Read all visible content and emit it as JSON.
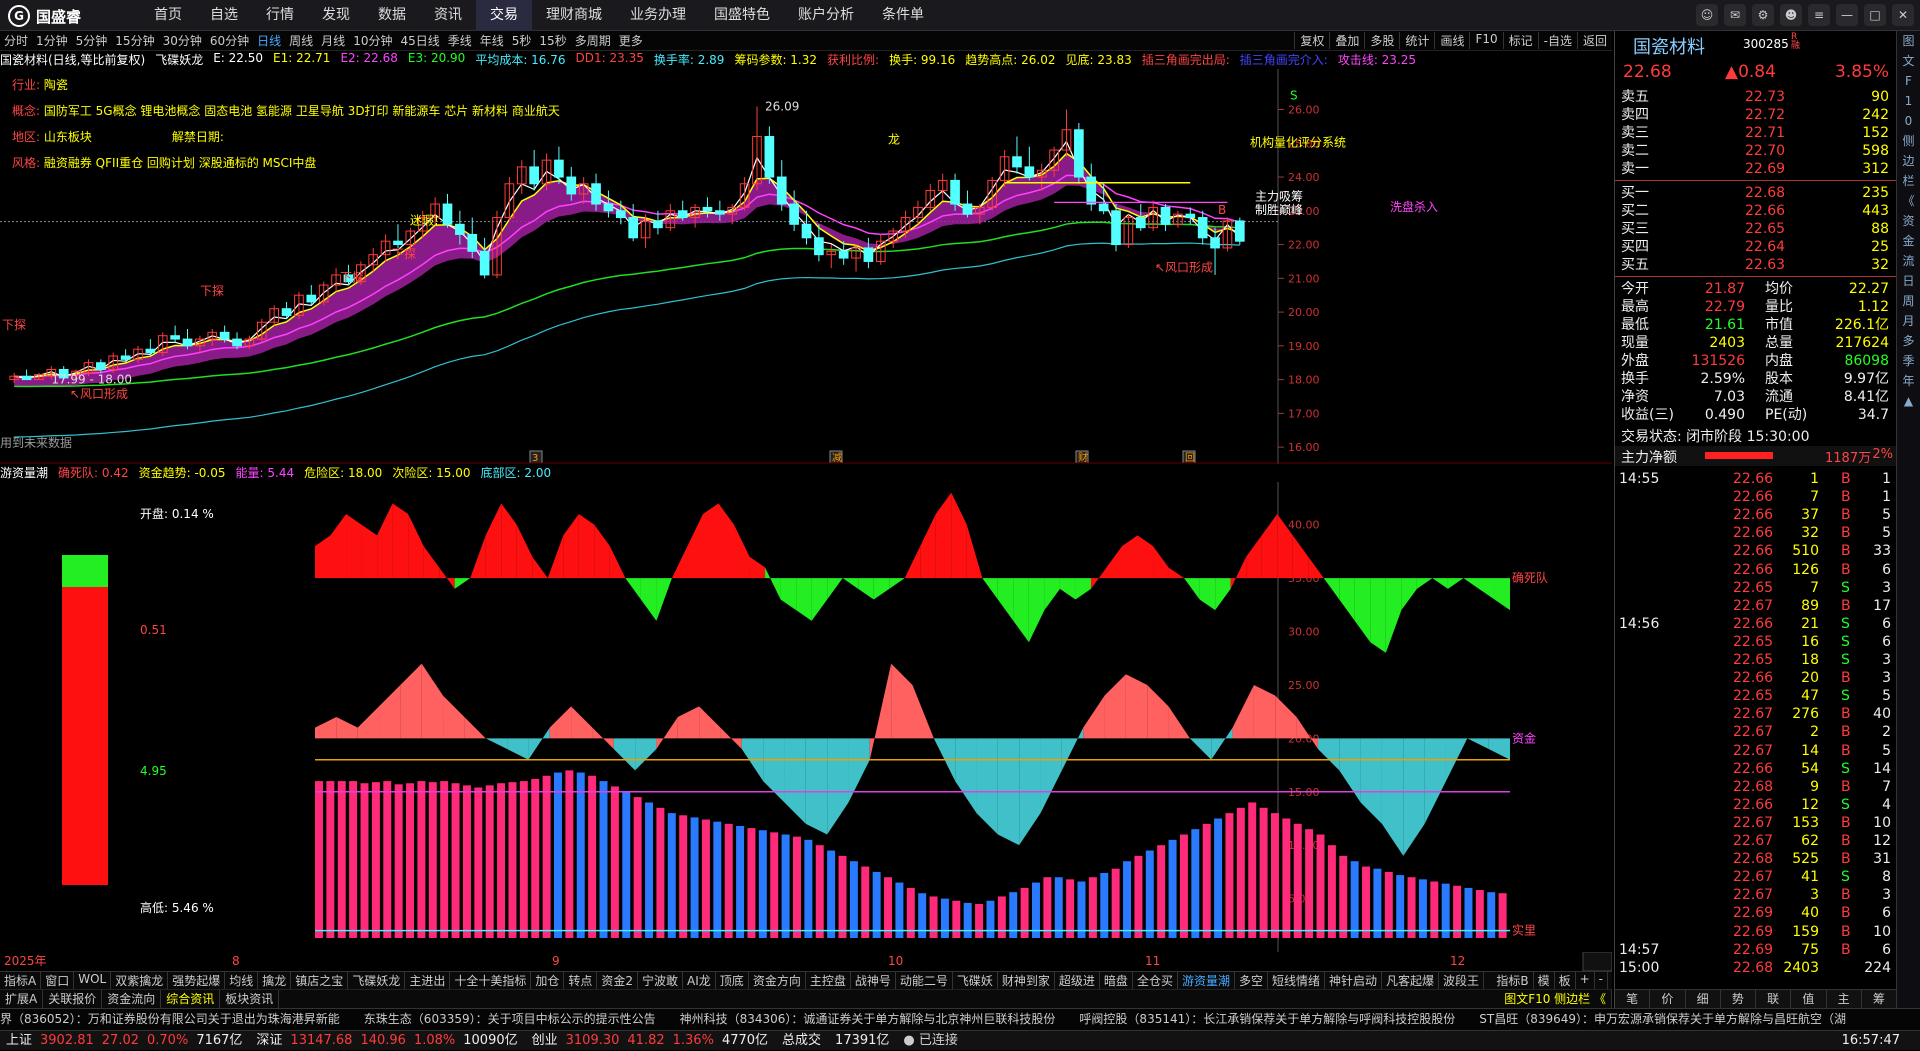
{
  "app": {
    "name": "国盛睿",
    "menu": [
      "首页",
      "自选",
      "行情",
      "发现",
      "数据",
      "资讯",
      "交易",
      "理财商城",
      "业务办理",
      "国盛特色",
      "账户分析",
      "条件单"
    ],
    "active_menu": "交易"
  },
  "periods": [
    "分时",
    "1分钟",
    "5分钟",
    "15分钟",
    "30分钟",
    "60分钟",
    "日线",
    "周线",
    "月线",
    "10分钟",
    "45日线",
    "季线",
    "年线",
    "5秒",
    "15秒",
    "多周期",
    "更多"
  ],
  "active_period": "日线",
  "toolbar": [
    "复权",
    "叠加",
    "多股",
    "统计",
    "画线",
    "F10",
    "标记",
    "-自选",
    "返回"
  ],
  "indicator_line": [
    {
      "t": "国瓷材料(日线,等比前复权)",
      "c": "#fff"
    },
    {
      "t": "飞碟妖龙",
      "c": "#fff"
    },
    {
      "t": "E: 22.50",
      "c": "#fff"
    },
    {
      "t": "E1: 22.71",
      "c": "#ff0"
    },
    {
      "t": "E2: 22.68",
      "c": "#f4f"
    },
    {
      "t": "E3: 20.90",
      "c": "#2f2"
    },
    {
      "t": "平均成本: 16.76",
      "c": "#4ef"
    },
    {
      "t": "DD1: 23.35",
      "c": "#f44"
    },
    {
      "t": "换手率: 2.89",
      "c": "#4ef"
    },
    {
      "t": "筹码参数: 1.32",
      "c": "#ff0"
    },
    {
      "t": "获利比例:",
      "c": "#f44"
    },
    {
      "t": "换手: 99.16",
      "c": "#ff0"
    },
    {
      "t": "趋势高点: 26.02",
      "c": "#ff0"
    },
    {
      "t": "见底: 23.83",
      "c": "#ff0"
    },
    {
      "t": "插三角画完出局:",
      "c": "#f44"
    },
    {
      "t": "插三角画完介入:",
      "c": "#44f"
    },
    {
      "t": "攻击线: 23.25",
      "c": "#f4f"
    }
  ],
  "info": [
    {
      "k": "行业:",
      "v": "陶瓷"
    },
    {
      "k": "概念:",
      "v": "国防军工 5G概念 锂电池概念 固态电池 氢能源 卫星导航 3D打印 新能源车 芯片 新材料 商业航天"
    },
    {
      "k": "地区:",
      "v": "山东板块",
      "k2": "解禁日期:",
      "v2": ""
    },
    {
      "k": "风格:",
      "v": "融资融券 QFII重仓 回购计划 深股通标的 MSCI中盘"
    }
  ],
  "main_axis": {
    "ylim": [
      15.5,
      27.2
    ],
    "ticks": [
      16,
      17,
      18,
      19,
      20,
      21,
      22,
      23,
      24,
      25,
      26
    ],
    "last_price": 22.68
  },
  "chart_data": {
    "type": "candlestick",
    "title": "国瓷材料(日线,等比前复权)",
    "ohlc": [
      [
        18.0,
        18.2,
        17.9,
        18.1
      ],
      [
        18.1,
        18.3,
        17.99,
        18.0
      ],
      [
        18.0,
        18.2,
        17.99,
        18.15
      ],
      [
        18.1,
        18.4,
        18.0,
        18.3
      ],
      [
        18.3,
        18.4,
        18.0,
        18.05
      ],
      [
        18.05,
        18.3,
        18.0,
        18.25
      ],
      [
        18.2,
        18.6,
        18.1,
        18.5
      ],
      [
        18.5,
        18.6,
        18.2,
        18.3
      ],
      [
        18.3,
        18.8,
        18.2,
        18.7
      ],
      [
        18.7,
        18.9,
        18.5,
        18.6
      ],
      [
        18.6,
        19.0,
        18.5,
        18.9
      ],
      [
        18.9,
        19.2,
        18.7,
        18.8
      ],
      [
        18.8,
        19.4,
        18.7,
        19.3
      ],
      [
        19.3,
        19.6,
        19.1,
        19.2
      ],
      [
        19.2,
        19.5,
        18.9,
        19.0
      ],
      [
        19.0,
        19.3,
        18.8,
        19.2
      ],
      [
        19.2,
        19.5,
        19.0,
        19.4
      ],
      [
        19.4,
        19.6,
        19.1,
        19.2
      ],
      [
        19.2,
        19.4,
        18.9,
        19.0
      ],
      [
        19.0,
        19.3,
        18.9,
        19.2
      ],
      [
        19.2,
        19.8,
        19.1,
        19.7
      ],
      [
        19.7,
        20.2,
        19.6,
        20.1
      ],
      [
        20.1,
        20.3,
        19.8,
        19.9
      ],
      [
        19.9,
        20.6,
        19.8,
        20.5
      ],
      [
        20.5,
        20.8,
        20.2,
        20.3
      ],
      [
        20.3,
        20.9,
        20.2,
        20.8
      ],
      [
        20.8,
        21.3,
        20.6,
        21.1
      ],
      [
        21.1,
        21.4,
        20.8,
        20.9
      ],
      [
        20.9,
        21.5,
        20.8,
        21.4
      ],
      [
        21.4,
        21.9,
        21.2,
        21.7
      ],
      [
        21.7,
        22.3,
        21.5,
        22.1
      ],
      [
        22.1,
        22.6,
        21.9,
        22.0
      ],
      [
        22.0,
        22.5,
        21.8,
        22.4
      ],
      [
        22.4,
        23.0,
        22.2,
        22.8
      ],
      [
        22.8,
        23.4,
        22.6,
        23.2
      ],
      [
        23.2,
        23.5,
        22.5,
        22.6
      ],
      [
        22.6,
        23.0,
        22.0,
        22.3
      ],
      [
        22.3,
        22.8,
        21.6,
        21.8
      ],
      [
        21.8,
        22.2,
        21.0,
        21.1
      ],
      [
        21.1,
        23.0,
        21.0,
        22.8
      ],
      [
        22.8,
        24.0,
        22.7,
        23.8
      ],
      [
        23.8,
        24.5,
        23.5,
        24.3
      ],
      [
        24.3,
        24.8,
        23.6,
        23.8
      ],
      [
        23.8,
        24.7,
        23.6,
        24.5
      ],
      [
        24.5,
        24.9,
        23.8,
        24.0
      ],
      [
        24.0,
        24.3,
        23.3,
        23.5
      ],
      [
        23.5,
        24.0,
        23.2,
        23.8
      ],
      [
        23.8,
        24.1,
        23.0,
        23.2
      ],
      [
        23.2,
        23.6,
        22.8,
        23.0
      ],
      [
        23.0,
        23.3,
        22.6,
        22.8
      ],
      [
        22.8,
        23.2,
        22.1,
        22.2
      ],
      [
        22.2,
        22.9,
        21.9,
        22.7
      ],
      [
        22.7,
        23.0,
        22.3,
        22.5
      ],
      [
        22.5,
        23.2,
        22.4,
        23.0
      ],
      [
        23.0,
        23.3,
        22.7,
        22.8
      ],
      [
        22.8,
        23.2,
        22.5,
        23.1
      ],
      [
        23.1,
        23.4,
        22.8,
        23.0
      ],
      [
        23.0,
        23.3,
        22.7,
        22.9
      ],
      [
        22.9,
        23.2,
        22.6,
        23.1
      ],
      [
        23.1,
        24.0,
        23.0,
        23.8
      ],
      [
        23.8,
        26.09,
        23.6,
        25.2
      ],
      [
        25.2,
        25.5,
        23.8,
        24.0
      ],
      [
        24.0,
        24.5,
        23.0,
        23.2
      ],
      [
        23.2,
        23.6,
        22.4,
        22.6
      ],
      [
        22.6,
        23.0,
        22.0,
        22.2
      ],
      [
        22.2,
        22.6,
        21.5,
        21.7
      ],
      [
        21.7,
        22.0,
        21.3,
        21.8
      ],
      [
        21.8,
        22.1,
        21.4,
        21.6
      ],
      [
        21.6,
        22.0,
        21.2,
        21.9
      ],
      [
        21.9,
        22.2,
        21.3,
        21.5
      ],
      [
        21.5,
        22.3,
        21.4,
        22.1
      ],
      [
        22.1,
        22.5,
        21.9,
        22.4
      ],
      [
        22.4,
        23.0,
        22.2,
        22.8
      ],
      [
        22.8,
        23.3,
        22.6,
        23.1
      ],
      [
        23.1,
        23.8,
        23.0,
        23.6
      ],
      [
        23.6,
        24.1,
        23.3,
        23.9
      ],
      [
        23.9,
        24.1,
        23.0,
        23.2
      ],
      [
        23.2,
        23.6,
        22.8,
        22.9
      ],
      [
        22.9,
        23.2,
        22.6,
        23.1
      ],
      [
        23.1,
        24.0,
        23.0,
        23.9
      ],
      [
        23.9,
        24.8,
        23.7,
        24.6
      ],
      [
        24.6,
        25.2,
        24.1,
        24.3
      ],
      [
        24.3,
        24.9,
        23.9,
        24.0
      ],
      [
        24.0,
        24.4,
        23.6,
        24.2
      ],
      [
        24.2,
        24.9,
        24.0,
        24.8
      ],
      [
        24.8,
        26.0,
        24.6,
        25.4
      ],
      [
        25.4,
        25.6,
        23.8,
        24.0
      ],
      [
        24.0,
        24.4,
        23.0,
        23.2
      ],
      [
        23.2,
        23.8,
        22.9,
        23.0
      ],
      [
        23.0,
        23.2,
        21.8,
        22.0
      ],
      [
        22.0,
        22.9,
        21.9,
        22.8
      ],
      [
        22.8,
        23.2,
        22.4,
        22.5
      ],
      [
        22.5,
        23.3,
        22.4,
        23.1
      ],
      [
        23.1,
        23.2,
        22.4,
        22.6
      ],
      [
        22.6,
        23.0,
        22.5,
        22.9
      ],
      [
        22.9,
        23.1,
        22.6,
        22.8
      ],
      [
        22.8,
        23.0,
        22.0,
        22.2
      ],
      [
        22.2,
        22.5,
        21.1,
        21.9
      ],
      [
        21.9,
        22.8,
        21.8,
        22.7
      ],
      [
        22.7,
        22.8,
        22.0,
        22.1
      ]
    ],
    "ma_series": [
      {
        "name": "E1",
        "color": "#ffff00",
        "last": 22.71
      },
      {
        "name": "E2",
        "color": "#ff40ff",
        "last": 22.68
      },
      {
        "name": "E3",
        "color": "#22dd22",
        "last": 20.9
      }
    ],
    "annotations": [
      {
        "t": "26.09",
        "c": "#ddd"
      },
      {
        "t": "17.99 - 18.00",
        "c": "#ddd"
      },
      {
        "t": "迷瑕!",
        "c": "#ff0"
      },
      {
        "t": "下探",
        "c": "#f44"
      },
      {
        "t": "下探",
        "c": "#f44"
      },
      {
        "t": "下探",
        "c": "#f44"
      },
      {
        "t": "下探",
        "c": "#f44"
      },
      {
        "t": "↖风口形成",
        "c": "#f44"
      },
      {
        "t": "↖风口形成",
        "c": "#f44"
      },
      {
        "t": "机构量化评分系统",
        "c": "#ff0"
      },
      {
        "t": "主力吸筹",
        "c": "#fff"
      },
      {
        "t": "制胜巅峰",
        "c": "#fff"
      },
      {
        "t": "洗盘杀入",
        "c": "#f4f"
      },
      {
        "t": "用到未来数据",
        "c": "#999"
      },
      {
        "t": "龙",
        "c": "#ff0"
      },
      {
        "t": "S",
        "c": "#2f2"
      },
      {
        "t": "B",
        "c": "#f44"
      }
    ],
    "event_markers": [
      "3",
      "减",
      "财",
      "回"
    ]
  },
  "sub_indicator": {
    "title": "游资量潮",
    "items": [
      {
        "t": "游资量潮",
        "c": "#fff"
      },
      {
        "t": "确死队: 0.42",
        "c": "#f44"
      },
      {
        "t": "资金趋势: -0.05",
        "c": "#ff0"
      },
      {
        "t": "能量: 5.44",
        "c": "#f4f"
      },
      {
        "t": "危险区: 18.00",
        "c": "#ff0"
      },
      {
        "t": "次险区: 15.00",
        "c": "#ff0"
      },
      {
        "t": "底部区: 2.00",
        "c": "#4ef"
      }
    ],
    "left_labels": [
      {
        "t": "开盘:",
        "v": "0.14 %"
      },
      {
        "t": "",
        "v": "0.51"
      },
      {
        "t": "",
        "v": "4.95"
      },
      {
        "t": "高低:",
        "v": "5.46 %"
      }
    ],
    "axis_ticks": [
      5,
      10,
      15,
      20,
      25,
      30,
      35,
      40
    ],
    "right_labels": [
      "确死队",
      "资金",
      "实里"
    ],
    "series_a": [
      38,
      39,
      41,
      40,
      39,
      42,
      41,
      38,
      36,
      34,
      35,
      39,
      42,
      40,
      37,
      35,
      39,
      41,
      40,
      38,
      35,
      33,
      31,
      35,
      38,
      41,
      42,
      40,
      37,
      36,
      33,
      32,
      31,
      33,
      35,
      34,
      33,
      34,
      35,
      38,
      41,
      43,
      40,
      35,
      33,
      31,
      29,
      32,
      34,
      33,
      34,
      36,
      38,
      39,
      38,
      36,
      35,
      33,
      32,
      34,
      37,
      39,
      41,
      39,
      37,
      35,
      33,
      31,
      29,
      28,
      32,
      34,
      35,
      34,
      35,
      34,
      33,
      32
    ],
    "series_b": [
      21,
      22,
      21,
      23,
      25,
      27,
      24,
      22,
      20,
      19,
      18,
      21,
      23,
      21,
      19,
      17,
      19,
      22,
      23,
      21,
      19,
      16,
      14,
      12,
      11,
      14,
      18,
      27,
      25,
      20,
      16,
      13,
      11,
      10,
      13,
      17,
      21,
      24,
      26,
      25,
      23,
      20,
      18,
      21,
      25,
      24,
      22,
      19,
      17,
      14,
      12,
      9,
      12,
      16,
      20,
      19,
      18
    ],
    "bars": [
      16,
      16,
      16,
      16,
      15.8,
      15.9,
      16,
      15.7,
      15.8,
      16,
      15.9,
      16,
      15.8,
      15.6,
      15.4,
      15.6,
      15.8,
      15.9,
      16,
      16.2,
      16.5,
      16.8,
      17,
      16.8,
      16.5,
      16,
      15.5,
      15,
      14.5,
      14,
      13.5,
      13,
      12.8,
      12.6,
      12.4,
      12.2,
      12,
      11.8,
      11.6,
      11.4,
      11.2,
      11,
      10.8,
      10.5,
      10,
      9.5,
      9,
      8.5,
      8,
      7.5,
      7,
      6.5,
      6,
      5.5,
      5.2,
      5,
      4.8,
      4.6,
      4.5,
      4.8,
      5.2,
      5.6,
      6,
      6.5,
      7,
      7,
      6.8,
      6.6,
      7,
      7.4,
      7.8,
      8.5,
      9,
      9.5,
      10,
      10.5,
      11,
      11.5,
      12,
      12.5,
      13,
      13.5,
      14,
      13.5,
      13,
      12.5,
      12,
      11.5,
      11,
      10,
      9,
      8.5,
      8,
      7.8,
      7.5,
      7.2,
      7,
      6.8,
      6.6,
      6.4,
      6.2,
      6,
      5.8,
      5.6,
      5.5
    ]
  },
  "x_axis_labels": [
    "2025年",
    "8",
    "9",
    "10",
    "11",
    "12",
    "日线"
  ],
  "bottom_tabs": [
    "指标A",
    "窗口",
    "WOL",
    "双紫擒龙",
    "强势起爆",
    "均线",
    "擒龙",
    "镇店之宝",
    "飞碟妖龙",
    "主进出",
    "十全十美指标",
    "加仓",
    "转点",
    "资金2",
    "宁波敢",
    "AI龙",
    "顶底",
    "资金方向",
    "主控盘",
    "战神号",
    "动能二号",
    "飞碟妖",
    "财神到家",
    "超级进",
    "暗盘",
    "全仓买",
    "游资量潮",
    "多空",
    "短线情绪",
    "神针启动",
    "凡客起爆",
    "波段王"
  ],
  "active_bottom_tab": "游资量潮",
  "bottom_tabs_right": [
    "指标B",
    "模",
    "板",
    "+",
    "-"
  ],
  "bottom_tabs2": [
    "扩展A",
    "关联报价",
    "资金流向",
    "综合资讯",
    "板块资讯"
  ],
  "active_bottom_tab2": "综合资讯",
  "ticker": "界（836052）：万和证券股份有限公司关于退出为珠海港昇新能　　东珠生态（603359）：关于项目中标公示的提示性公告　　神州科技（834306）：诚通证券关于单方解除与北京神州巨联科技股份　　呼阀控股（835141）：长江承销保荐关于单方解除与呼阀科技控股股份　　ST昌旺（839649）：申万宏源承销保荐关于单方解除与昌旺航空（湖",
  "status": [
    {
      "name": "上证",
      "v": "3902.81",
      "c": "27.02",
      "p": "0.70%",
      "a": "7167亿"
    },
    {
      "name": "深证",
      "v": "13147.68",
      "c": "140.96",
      "p": "1.08%",
      "a": "10090亿"
    },
    {
      "name": "创业",
      "v": "3109.30",
      "c": "41.82",
      "p": "1.36%",
      "a": "4770亿"
    }
  ],
  "status_extra": {
    "total_label": "总成交",
    "total": "17391亿",
    "conn": "已连接",
    "time": "16:57:47"
  },
  "quote": {
    "name": "国瓷材料",
    "code": "300285",
    "tag": "R 融",
    "price": "22.68",
    "change": "▲0.84",
    "pct": "3.85%",
    "asks": [
      [
        "卖五",
        "22.73",
        "90"
      ],
      [
        "卖四",
        "22.72",
        "242"
      ],
      [
        "卖三",
        "22.71",
        "152"
      ],
      [
        "卖二",
        "22.70",
        "598"
      ],
      [
        "卖一",
        "22.69",
        "312"
      ]
    ],
    "bids": [
      [
        "买一",
        "22.68",
        "235"
      ],
      [
        "买二",
        "22.66",
        "443"
      ],
      [
        "买三",
        "22.65",
        "88"
      ],
      [
        "买四",
        "22.64",
        "25"
      ],
      [
        "买五",
        "22.63",
        "32"
      ]
    ],
    "stats": [
      [
        "今开",
        "21.87",
        "均价",
        "22.27"
      ],
      [
        "最高",
        "22.79",
        "量比",
        "1.12"
      ],
      [
        "最低",
        "21.61",
        "市值",
        "226.1亿"
      ],
      [
        "现量",
        "2403",
        "总量",
        "217624"
      ],
      [
        "外盘",
        "131526",
        "内盘",
        "86098"
      ],
      [
        "换手",
        "2.59%",
        "股本",
        "9.97亿"
      ],
      [
        "净资",
        "7.03",
        "流通",
        "8.41亿"
      ],
      [
        "收益(三)",
        "0.490",
        "PE(动)",
        "34.7"
      ]
    ],
    "trade_status": "交易状态: 闭市阶段 15:30:00",
    "net_flow": {
      "label": "主力净额",
      "value": "1187万",
      "pct": "2%",
      "fill": 0.62
    }
  },
  "ticks": [
    [
      "14:55",
      "22.66",
      "1",
      "B",
      "1"
    ],
    [
      "",
      "22.66",
      "7",
      "B",
      "1"
    ],
    [
      "",
      "22.66",
      "37",
      "B",
      "5"
    ],
    [
      "",
      "22.66",
      "32",
      "B",
      "5"
    ],
    [
      "",
      "22.66",
      "510",
      "B",
      "33"
    ],
    [
      "",
      "22.66",
      "126",
      "B",
      "6"
    ],
    [
      "",
      "22.65",
      "7",
      "S",
      "3"
    ],
    [
      "",
      "22.67",
      "89",
      "B",
      "17"
    ],
    [
      "14:56",
      "22.66",
      "21",
      "S",
      "6"
    ],
    [
      "",
      "22.65",
      "16",
      "S",
      "6"
    ],
    [
      "",
      "22.65",
      "18",
      "S",
      "3"
    ],
    [
      "",
      "22.66",
      "20",
      "B",
      "3"
    ],
    [
      "",
      "22.65",
      "47",
      "S",
      "5"
    ],
    [
      "",
      "22.67",
      "276",
      "B",
      "40"
    ],
    [
      "",
      "22.67",
      "2",
      "B",
      "2"
    ],
    [
      "",
      "22.67",
      "14",
      "B",
      "5"
    ],
    [
      "",
      "22.66",
      "54",
      "S",
      "14"
    ],
    [
      "",
      "22.68",
      "9",
      "B",
      "7"
    ],
    [
      "",
      "22.66",
      "12",
      "S",
      "4"
    ],
    [
      "",
      "22.67",
      "153",
      "B",
      "10"
    ],
    [
      "",
      "22.67",
      "62",
      "B",
      "12"
    ],
    [
      "",
      "22.68",
      "525",
      "B",
      "31"
    ],
    [
      "",
      "22.67",
      "41",
      "S",
      "8"
    ],
    [
      "",
      "22.67",
      "3",
      "B",
      "3"
    ],
    [
      "",
      "22.69",
      "40",
      "B",
      "6"
    ],
    [
      "",
      "22.69",
      "159",
      "B",
      "10"
    ],
    [
      "14:57",
      "22.69",
      "75",
      "B",
      "6"
    ],
    [
      "15:00",
      "22.68",
      "2403",
      "",
      "224"
    ]
  ],
  "rp_bottom_tabs": [
    "笔",
    "价",
    "细",
    "势",
    "联",
    "值",
    "主",
    "筹"
  ],
  "rside": [
    "图",
    "文",
    "F",
    "1",
    "0",
    "侧",
    "边",
    "栏",
    "《",
    "资",
    "金",
    "流",
    "日",
    "周",
    "月",
    "多",
    "季",
    "年",
    "▲"
  ],
  "bottom_right_btn": "图文F10 侧边栏 《"
}
